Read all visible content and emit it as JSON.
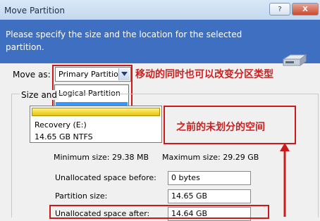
{
  "window": {
    "title": "Move Partition",
    "help_button": "?",
    "close_button": "X"
  },
  "banner": {
    "instruction": "Please specify the size and the location for the selected partition."
  },
  "move_as": {
    "label": "Move as:",
    "selected": "Primary Partition",
    "options": [
      "Logical Partition",
      "Primary Partition"
    ]
  },
  "annotations": {
    "change_type": "移动的同时也可以改变分区类型",
    "unallocated_before": "之前的未划分的空间"
  },
  "group": {
    "title": "Size and"
  },
  "partition": {
    "name": "Recovery (E:)",
    "info": "14.65 GB  NTFS"
  },
  "sizes": {
    "minimum": "Minimum size: 29.38 MB",
    "maximum": "Maximum size: 29.29 GB"
  },
  "fields": {
    "unallocated_before_label": "Unallocated space before:",
    "unallocated_before_value": "0 bytes",
    "partition_size_label": "Partition size:",
    "partition_size_value": "14.65 GB",
    "unallocated_after_label": "Unallocated space after:",
    "unallocated_after_value": "14.64 GB"
  },
  "colors": {
    "banner": "#3f6fc0",
    "annotation_red": "#cc1a1a",
    "selection_blue": "#3399ff",
    "partition_bar": "#e8c20c"
  }
}
